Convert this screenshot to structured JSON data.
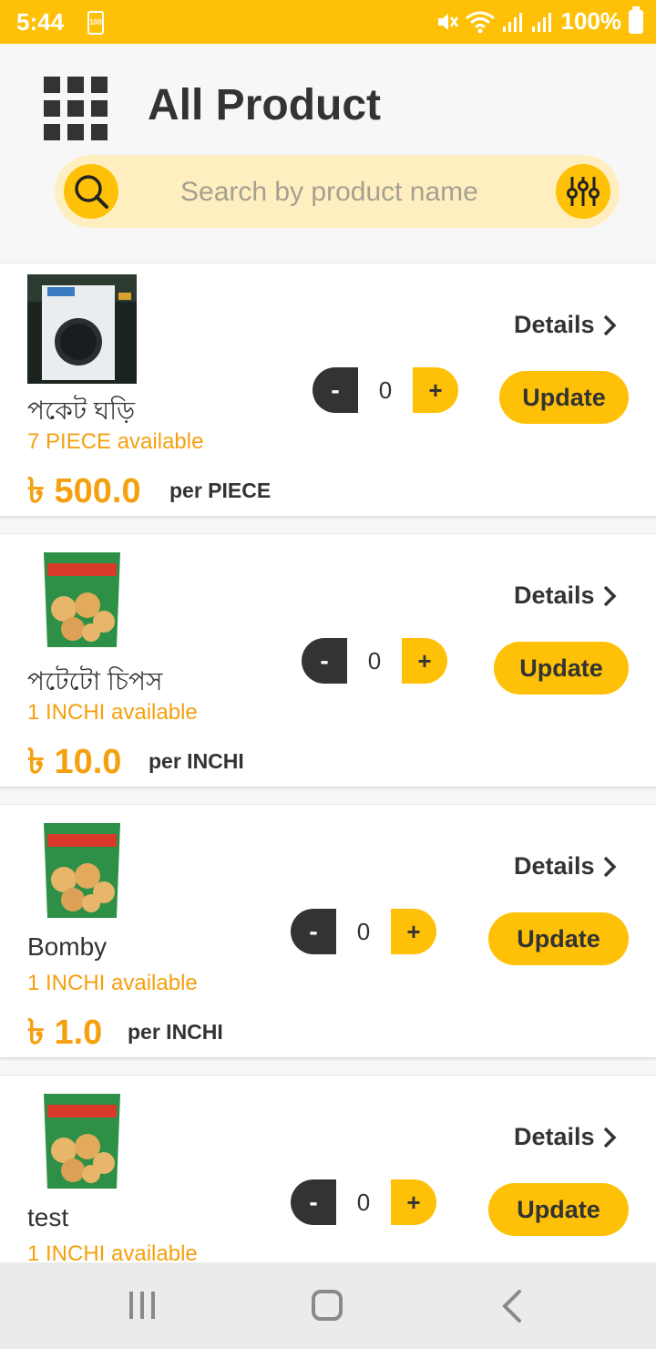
{
  "status": {
    "time": "5:44",
    "battery_small": "100",
    "battery": "100%"
  },
  "header": {
    "title": "All Product",
    "search_placeholder": "Search by product name"
  },
  "products": [
    {
      "name": "পকেট ঘড়ি",
      "available": "7 PIECE available",
      "price": "৳ 500.0",
      "unit": "per PIECE",
      "qty": "0",
      "details": "Details",
      "update": "Update",
      "minus": "-",
      "plus": "+",
      "thumb": "watch-box"
    },
    {
      "name": "পটেটো চিপস",
      "available": "1 INCHI available",
      "price": "৳ 10.0",
      "unit": "per INCHI",
      "qty": "0",
      "details": "Details",
      "update": "Update",
      "minus": "-",
      "plus": "+",
      "thumb": "potato-crackers"
    },
    {
      "name": "Bomby",
      "available": "1 INCHI available",
      "price": "৳ 1.0",
      "unit": "per INCHI",
      "qty": "0",
      "details": "Details",
      "update": "Update",
      "minus": "-",
      "plus": "+",
      "thumb": "potato-crackers"
    },
    {
      "name": "test",
      "available": "1 INCHI available",
      "price": "",
      "unit": "",
      "qty": "0",
      "details": "Details",
      "update": "Update",
      "minus": "-",
      "plus": "+",
      "thumb": "potato-crackers"
    }
  ],
  "colors": {
    "accent": "#ffc107",
    "price": "#f5a00f",
    "text": "#333333"
  }
}
